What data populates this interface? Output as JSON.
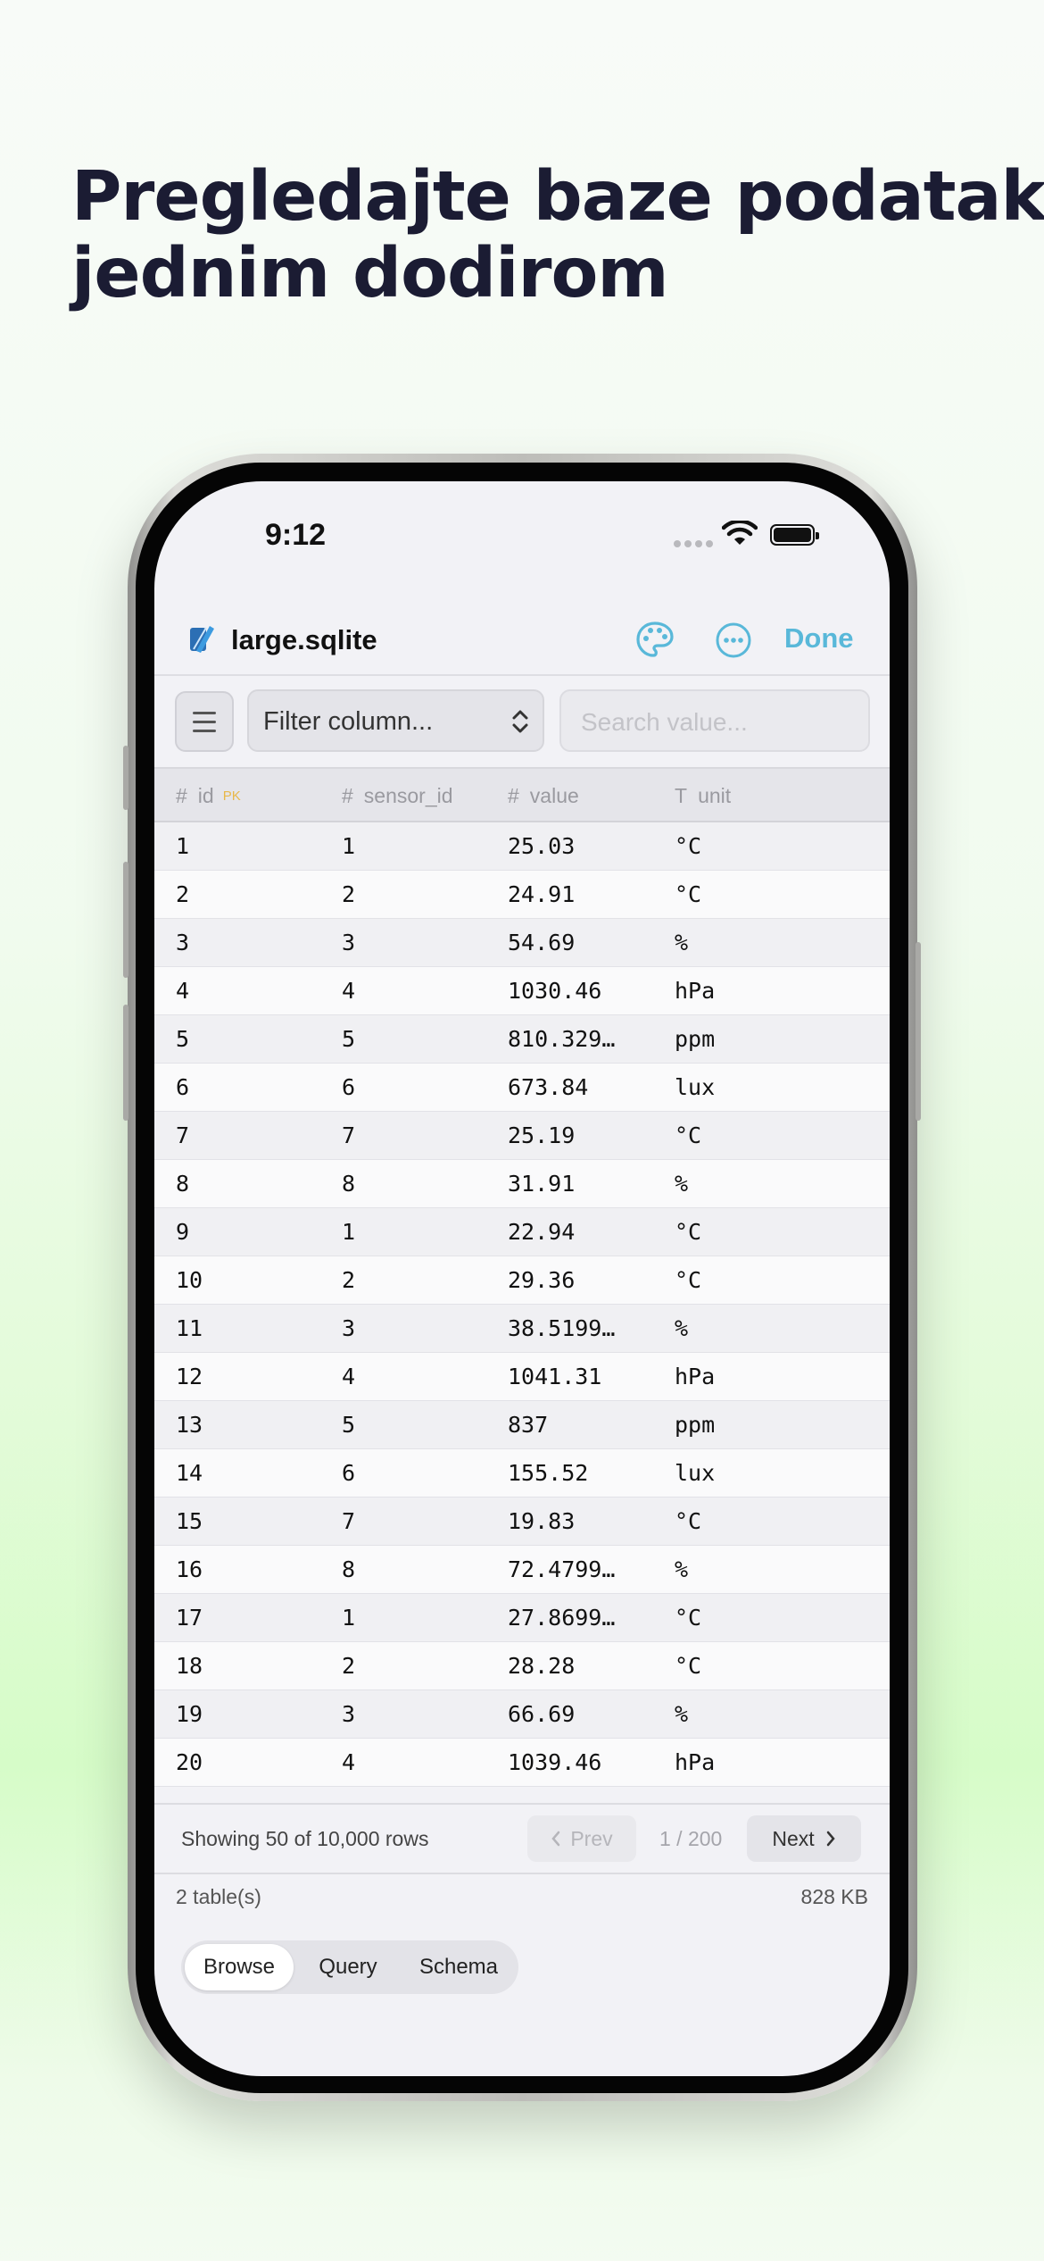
{
  "headline": {
    "line1": "Pregledajte baze podataka",
    "line2": "jednim dodirom"
  },
  "status_bar": {
    "time": "9:12"
  },
  "nav": {
    "file_name": "large.sqlite",
    "done_label": "Done",
    "icons": [
      "file-icon",
      "palette-icon",
      "more-icon"
    ]
  },
  "filter": {
    "column_placeholder": "Filter column...",
    "search_placeholder": "Search value..."
  },
  "table": {
    "columns": [
      {
        "type_symbol": "#",
        "name": "id",
        "badge": "PK"
      },
      {
        "type_symbol": "#",
        "name": "sensor_id",
        "badge": ""
      },
      {
        "type_symbol": "#",
        "name": "value",
        "badge": ""
      },
      {
        "type_symbol": "T",
        "name": "unit",
        "badge": ""
      }
    ],
    "rows": [
      [
        "1",
        "1",
        "25.03",
        "°C"
      ],
      [
        "2",
        "2",
        "24.91",
        "°C"
      ],
      [
        "3",
        "3",
        "54.69",
        "%"
      ],
      [
        "4",
        "4",
        "1030.46",
        "hPa"
      ],
      [
        "5",
        "5",
        "810.329…",
        "ppm"
      ],
      [
        "6",
        "6",
        "673.84",
        "lux"
      ],
      [
        "7",
        "7",
        "25.19",
        "°C"
      ],
      [
        "8",
        "8",
        "31.91",
        "%"
      ],
      [
        "9",
        "1",
        "22.94",
        "°C"
      ],
      [
        "10",
        "2",
        "29.36",
        "°C"
      ],
      [
        "11",
        "3",
        "38.5199…",
        "%"
      ],
      [
        "12",
        "4",
        "1041.31",
        "hPa"
      ],
      [
        "13",
        "5",
        "837",
        "ppm"
      ],
      [
        "14",
        "6",
        "155.52",
        "lux"
      ],
      [
        "15",
        "7",
        "19.83",
        "°C"
      ],
      [
        "16",
        "8",
        "72.4799…",
        "%"
      ],
      [
        "17",
        "1",
        "27.8699…",
        "°C"
      ],
      [
        "18",
        "2",
        "28.28",
        "°C"
      ],
      [
        "19",
        "3",
        "66.69",
        "%"
      ],
      [
        "20",
        "4",
        "1039.46",
        "hPa"
      ]
    ]
  },
  "pager": {
    "showing": "Showing 50 of 10,000 rows",
    "prev_label": "Prev",
    "page_indicator": "1 / 200",
    "next_label": "Next"
  },
  "footer": {
    "tables_count": "2 table(s)",
    "size": "828 KB"
  },
  "segments": {
    "items": [
      "Browse",
      "Query",
      "Schema"
    ],
    "selected": "Browse"
  },
  "colors": {
    "accent": "#59b8d9",
    "headline": "#1b1c33",
    "pk_badge": "#e8b84a"
  }
}
